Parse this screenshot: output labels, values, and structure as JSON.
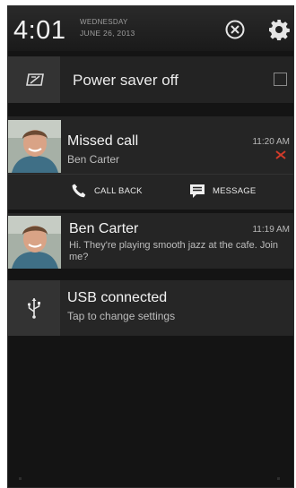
{
  "status": {
    "time": "4:01",
    "weekday": "WEDNESDAY",
    "date": "JUNE 26, 2013"
  },
  "header_icons": {
    "clear": "clear-all-icon",
    "settings": "gear-icon"
  },
  "power_saver": {
    "label": "Power saver off",
    "icon": "power-saver-icon",
    "checked": false
  },
  "notifications": [
    {
      "title": "Missed call",
      "subtitle": "Ben Carter",
      "time": "11:20 AM",
      "avatar": "contact-photo",
      "status_icon": "missed-call-icon",
      "actions": [
        {
          "label": "CALL BACK",
          "icon": "phone-icon"
        },
        {
          "label": "MESSAGE",
          "icon": "message-icon"
        }
      ]
    },
    {
      "title": "Ben Carter",
      "body": "Hi. They're playing smooth jazz at the cafe. Join me?",
      "time": "11:19 AM",
      "avatar": "contact-photo"
    },
    {
      "title": "USB connected",
      "subtitle": "Tap to change settings",
      "icon": "usb-icon"
    }
  ],
  "colors": {
    "background": "#141414",
    "card": "#252525",
    "text": "#f4f4f4",
    "missed": "#d23b2a"
  }
}
